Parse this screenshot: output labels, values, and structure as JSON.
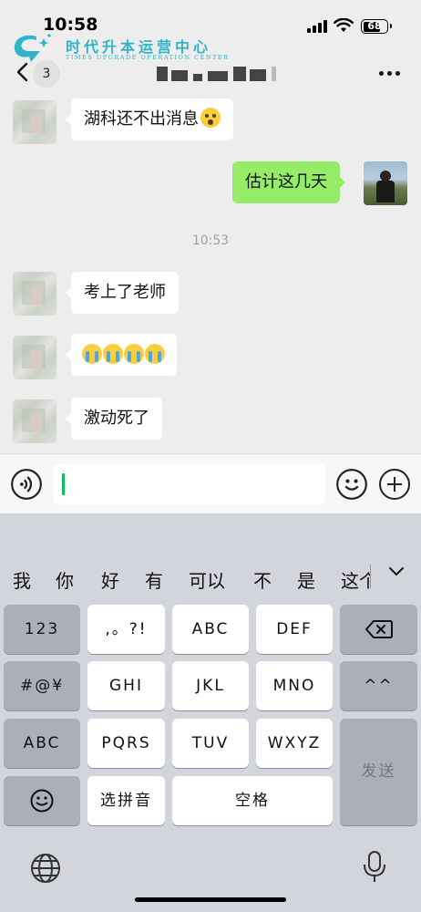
{
  "status_bar": {
    "time": "10:58",
    "battery": "68"
  },
  "watermark": {
    "title": "时代升本运营中心",
    "subtitle": "TIMES UPGRADE OPERATION CENTER"
  },
  "nav": {
    "unread_count": "3"
  },
  "messages": [
    {
      "side": "left",
      "text": "湖科还不出消息",
      "emoji": "flushed-face"
    },
    {
      "side": "right",
      "text": "估计这几天"
    },
    {
      "type": "time",
      "text": "10:53"
    },
    {
      "side": "left",
      "text": "考上了老师"
    },
    {
      "side": "left",
      "emoji": "loudly-crying-face x4"
    },
    {
      "side": "left",
      "text": "激动死了"
    }
  ],
  "keyboard": {
    "candidates": [
      "我",
      "你",
      "好",
      "有",
      "可以",
      "不",
      "是",
      "这个"
    ],
    "keys": {
      "num": "123",
      "punct": ",。?!",
      "abc": "ABC",
      "def": "DEF",
      "backspace": "delete-icon",
      "symbols": "#@¥",
      "ghi": "GHI",
      "jkl": "JKL",
      "mno": "MNO",
      "face": "^^",
      "abc_switch": "ABC",
      "pqrs": "PQRS",
      "tuv": "TUV",
      "wxyz": "WXYZ",
      "send": "发送",
      "emoji": "emoji-icon",
      "pinyin": "选拼音",
      "space": "空格"
    }
  },
  "colors": {
    "accent": "#95ec69",
    "caret": "#07c160",
    "watermark": "#2fb4c9"
  }
}
